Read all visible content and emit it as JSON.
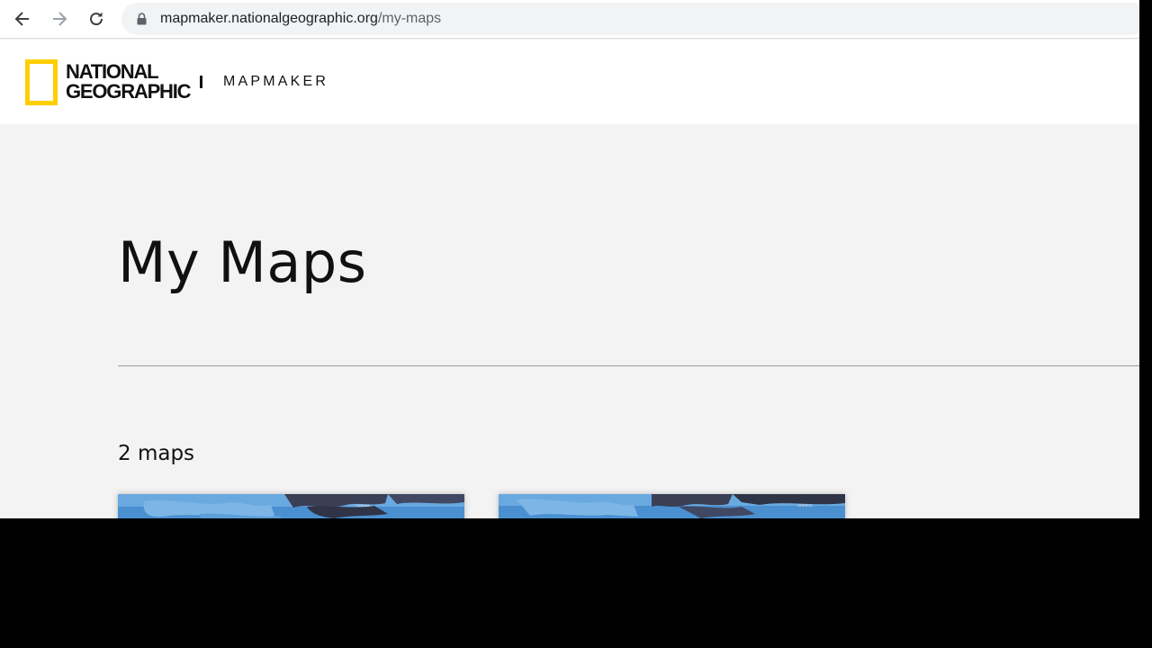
{
  "browser": {
    "url_domain": "mapmaker.nationalgeographic.org",
    "url_path": "/my-maps",
    "back_icon": "arrow-left-icon",
    "forward_icon": "arrow-right-icon",
    "reload_icon": "reload-icon",
    "lock_icon": "lock-icon"
  },
  "header": {
    "logo_line1": "NATIONAL",
    "logo_line2": "GEOGRAPHIC",
    "app_name": "MAPMAKER",
    "brand_color": "#ffce00"
  },
  "main": {
    "title": "My Maps",
    "count_label": "2 maps",
    "maps": [
      {
        "thumbnail": "map-thumbnail"
      },
      {
        "thumbnail": "map-thumbnail"
      }
    ]
  }
}
